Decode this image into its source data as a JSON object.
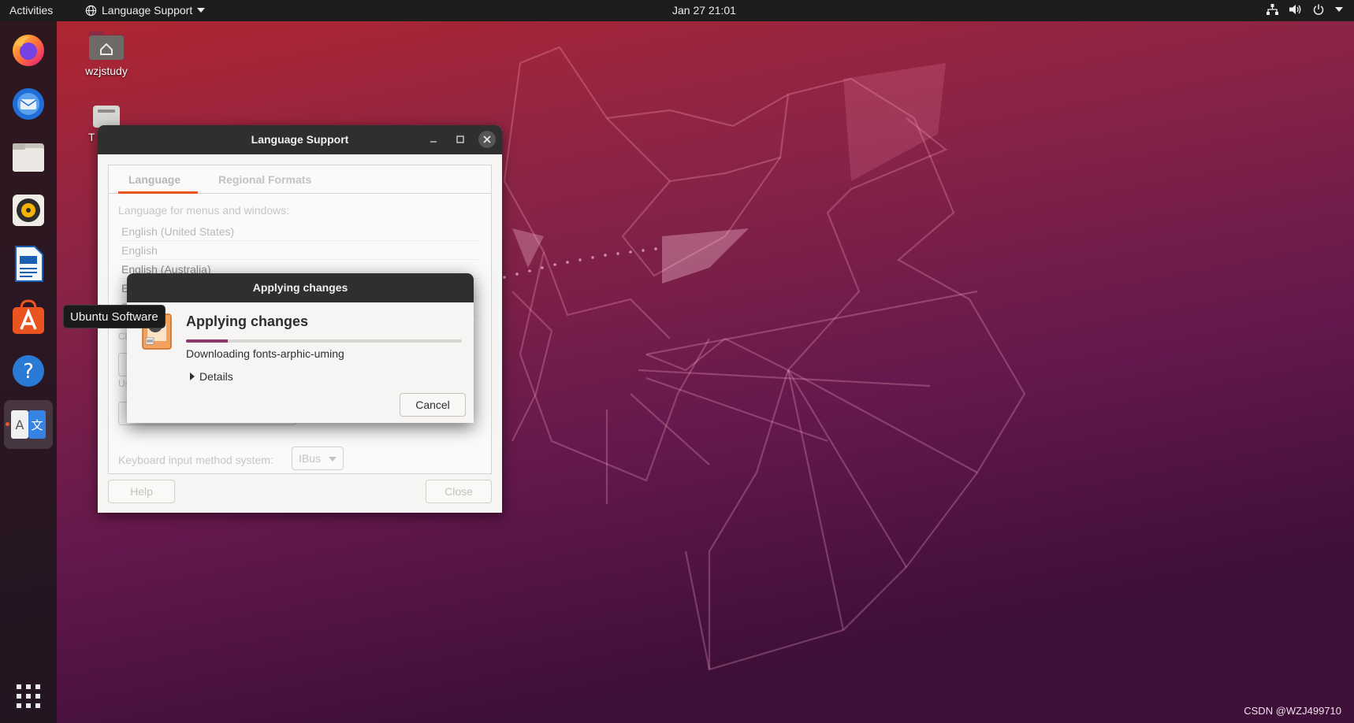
{
  "topbar": {
    "activities": "Activities",
    "app_menu": "Language Support",
    "clock": "Jan 27  21:01",
    "tray_icons": [
      "network-icon",
      "volume-icon",
      "power-icon"
    ]
  },
  "dock": {
    "items": [
      "firefox",
      "thunderbird",
      "files",
      "rhythmbox",
      "libreoffice-writer",
      "ubuntu-software",
      "help",
      "language-support"
    ],
    "tooltip": "Ubuntu Software"
  },
  "desktop": {
    "home_label": "wzjstudy",
    "trash_label": "T"
  },
  "language_window": {
    "title": "Language Support",
    "tabs": [
      "Language",
      "Regional Formats"
    ],
    "section_label": "Language for menus and windows:",
    "languages": [
      "English (United States)",
      "English",
      "English (Australia)",
      "E",
      "E"
    ],
    "partial_text": [
      "D",
      "Cl",
      "Us"
    ],
    "keyboard_label": "Keyboard input method system:",
    "keyboard_value": "IBus",
    "help_button": "Help",
    "close_button": "Close"
  },
  "dialog": {
    "title": "Applying changes",
    "heading": "Applying changes",
    "status": "Downloading fonts-arphic-uming",
    "details": "Details",
    "cancel": "Cancel",
    "progress": 0.15
  },
  "watermark": "CSDN @WZJ499710",
  "colors": {
    "accent": "#e95420",
    "progress": "#8a3a6a",
    "titlebar": "#2f2f2f"
  }
}
